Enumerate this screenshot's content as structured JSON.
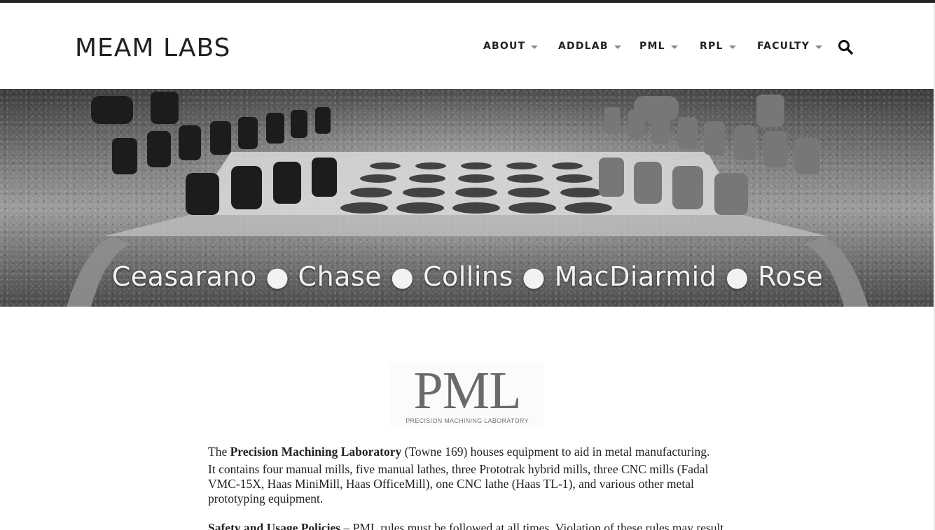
{
  "header": {
    "site_title": "MEAM LABS",
    "nav": [
      {
        "label": "ABOUT"
      },
      {
        "label": "ADDLAB"
      },
      {
        "label": "PML"
      },
      {
        "label": "RPL"
      },
      {
        "label": "FACULTY"
      }
    ],
    "search_icon": "search-icon"
  },
  "hero": {
    "caption": "Ceasarano ● Chase ● Collins ● MacDiarmid ● Rose"
  },
  "logo": {
    "title": "PML",
    "subtitle": "PRECISION MACHINING LABORATORY"
  },
  "content": {
    "intro_prefix": "The ",
    "intro_bold": "Precision Machining Laboratory",
    "intro_rest": " (Towne 169) houses equipment to aid in metal manufacturing.",
    "equipment": "It contains four manual mills, five manual lathes, three Prototrak hybrid mills, three CNC mills (Fadal VMC-15X, Haas MiniMill, Haas OfficeMill), one CNC lathe (Haas TL-1), and various other metal prototyping equipment.",
    "policies_bold": "Safety and Usage Policies",
    "policies_rest": " – PML rules must be followed at all times. Violation of these rules may result"
  },
  "colors": {
    "text": "#222222",
    "caret": "#888888",
    "logo_gray": "#6a6a6a"
  }
}
